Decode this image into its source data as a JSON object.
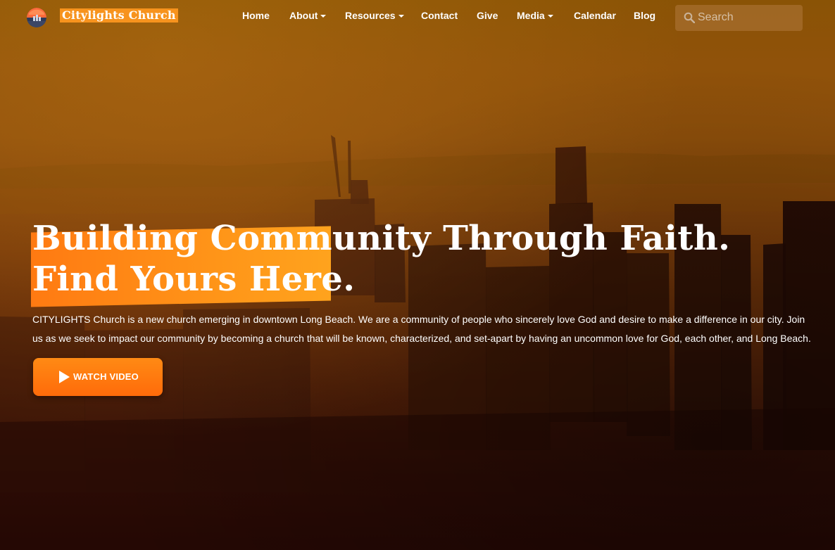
{
  "header": {
    "brand": "Citylights Church",
    "nav": [
      {
        "label": "Home",
        "dropdown": false
      },
      {
        "label": "About",
        "dropdown": true
      },
      {
        "label": "Resources",
        "dropdown": true
      },
      {
        "label": "Contact",
        "dropdown": false
      },
      {
        "label": "Give",
        "dropdown": false
      },
      {
        "label": "Media",
        "dropdown": true
      },
      {
        "label": "Calendar",
        "dropdown": false
      },
      {
        "label": "Blog",
        "dropdown": false
      }
    ],
    "search": {
      "placeholder": "Search",
      "value": ""
    }
  },
  "hero": {
    "headline_line1": "Building Community Through Faith.",
    "headline_line2": "Find Yours Here.",
    "intro": "CITYLIGHTS Church is a new church emerging in downtown Long Beach. We are a community of people who sincerely love God and desire to make a difference in our city. Join us as we seek to impact our community by becoming a church that will be known, characterized, and set-apart by having an uncommon love for God, each other, and Long Beach.",
    "button_label": "WATCH VIDEO"
  },
  "theme": {
    "accent": "#ff7a12",
    "brand_highlight": "#f7931d"
  },
  "icons": {
    "logo": "sunset-city-logo-icon",
    "search": "search-icon",
    "play": "play-icon"
  }
}
